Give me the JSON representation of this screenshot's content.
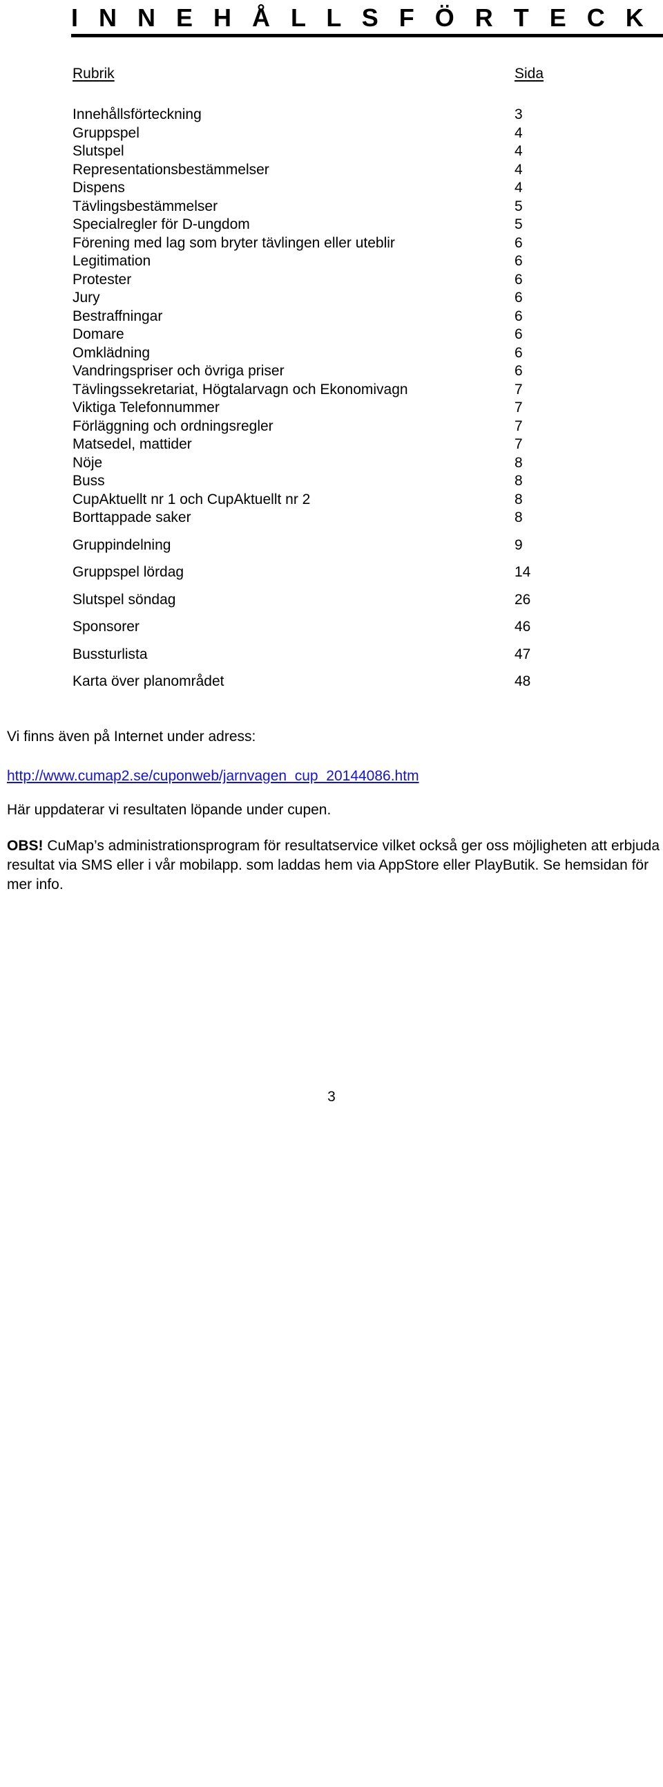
{
  "document": {
    "title": "I N N E H Å L L S F Ö R T E C K N I N G",
    "page_number": "3"
  },
  "toc": {
    "header": {
      "column_title": "Rubrik",
      "column_page": "Sida"
    },
    "entries": [
      {
        "label": "Innehållsförteckning",
        "page": "3",
        "spaced": false
      },
      {
        "label": "Gruppspel",
        "page": "4",
        "spaced": false
      },
      {
        "label": "Slutspel",
        "page": "4",
        "spaced": false
      },
      {
        "label": "Representationsbestämmelser",
        "page": "4",
        "spaced": false
      },
      {
        "label": "Dispens",
        "page": "4",
        "spaced": false
      },
      {
        "label": "Tävlingsbestämmelser",
        "page": "5",
        "spaced": false
      },
      {
        "label": "Specialregler för D-ungdom",
        "page": "5",
        "spaced": false
      },
      {
        "label": "Förening med lag som bryter tävlingen eller uteblir",
        "page": "6",
        "spaced": false
      },
      {
        "label": "Legitimation",
        "page": "6",
        "spaced": false
      },
      {
        "label": "Protester",
        "page": "6",
        "spaced": false
      },
      {
        "label": "Jury",
        "page": "6",
        "spaced": false
      },
      {
        "label": "Bestraffningar",
        "page": "6",
        "spaced": false
      },
      {
        "label": "Domare",
        "page": "6",
        "spaced": false
      },
      {
        "label": "Omklädning",
        "page": "6",
        "spaced": false
      },
      {
        "label": "Vandringspriser och övriga priser",
        "page": "6",
        "spaced": false
      },
      {
        "label": "Tävlingssekretariat, Högtalarvagn och Ekonomivagn",
        "page": "7",
        "spaced": false
      },
      {
        "label": "Viktiga Telefonnummer",
        "page": "7",
        "spaced": false
      },
      {
        "label": "Förläggning och ordningsregler",
        "page": "7",
        "spaced": false
      },
      {
        "label": "Matsedel, mattider",
        "page": "7",
        "spaced": false
      },
      {
        "label": "Nöje",
        "page": "8",
        "spaced": false
      },
      {
        "label": "Buss",
        "page": "8",
        "spaced": false
      },
      {
        "label": "CupAktuellt nr 1 och CupAktuellt nr 2",
        "page": "8",
        "spaced": false
      },
      {
        "label": "Borttappade saker",
        "page": "8",
        "spaced": false
      },
      {
        "label": "Gruppindelning",
        "page": "9",
        "spaced": true
      },
      {
        "label": "Gruppspel lördag",
        "page": "14",
        "spaced": true
      },
      {
        "label": "Slutspel söndag",
        "page": "26",
        "spaced": true
      },
      {
        "label": "Sponsorer",
        "page": "46",
        "spaced": true
      },
      {
        "label": "Bussturlista",
        "page": "47",
        "spaced": true
      },
      {
        "label": "Karta över planområdet",
        "page": "48",
        "spaced": true
      }
    ]
  },
  "notes": {
    "internet_intro": "Vi finns även på Internet under adress:",
    "url": "http://www.cumap2.se/cuponweb/jarnvagen_cup_20144086.htm",
    "update_line": "Här uppdaterar vi resultaten löpande under cupen.",
    "obs_prefix": "OBS!",
    "obs_text": " CuMap’s administrationsprogram för resultatservice vilket också ger oss möjligheten att erbjuda resultat via SMS eller i vår mobilapp. som laddas hem via AppStore eller PlayButik. Se hemsidan för mer info."
  },
  "colors": {
    "text": "#000000",
    "link": "#1414cc",
    "background": "#ffffff"
  }
}
